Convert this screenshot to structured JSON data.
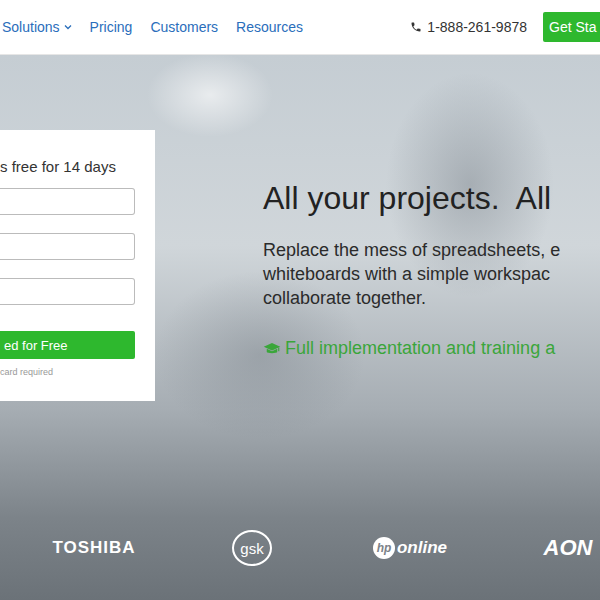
{
  "nav": {
    "links": [
      {
        "label": "Solutions",
        "dropdown": true
      },
      {
        "label": "Pricing",
        "dropdown": false
      },
      {
        "label": "Customers",
        "dropdown": false
      },
      {
        "label": "Resources",
        "dropdown": false
      }
    ],
    "phone": "1-888-261-9878",
    "cta": "Get Sta"
  },
  "signup": {
    "title": "s free for 14 days",
    "fields": [
      {
        "value": ""
      },
      {
        "value": ""
      },
      {
        "value": ""
      }
    ],
    "button": "ed for Free",
    "note": "card required"
  },
  "hero": {
    "headline": "All your projects.  All",
    "lines": [
      "Replace the mess of spreadsheets, e",
      "whiteboards with a simple workspac",
      "collaborate together."
    ],
    "feature": "Full implementation and training a"
  },
  "logos": [
    {
      "kind": "wordmark",
      "mark": "",
      "text": "TOSHIBA"
    },
    {
      "kind": "circle",
      "mark": "",
      "text": "gsk"
    },
    {
      "kind": "hp",
      "mark": "hp",
      "text": "online"
    },
    {
      "kind": "italic",
      "mark": "",
      "text": "AON"
    }
  ]
}
